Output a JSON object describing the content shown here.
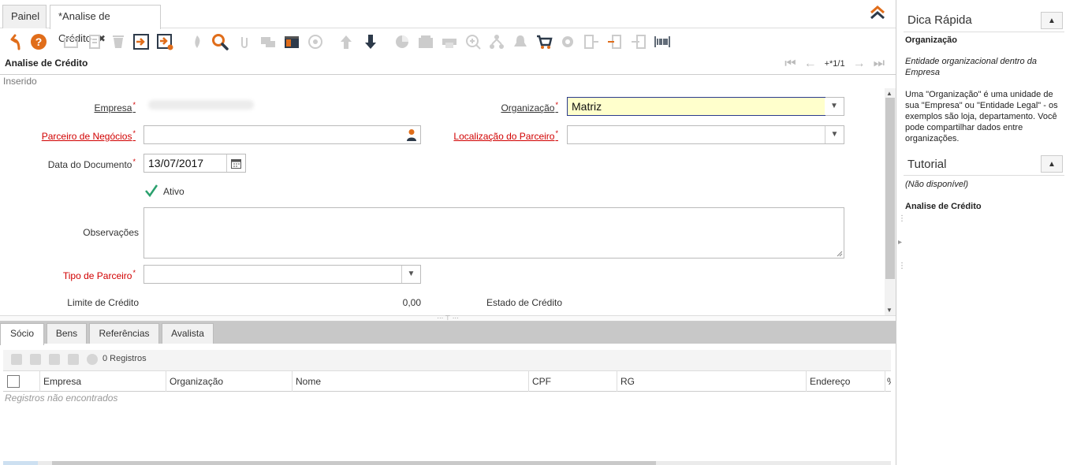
{
  "tabs": [
    {
      "label": "Painel"
    },
    {
      "label": "*Analise de Crédito",
      "close": "✖"
    }
  ],
  "colors": {
    "accent": "#e06d1a",
    "required": "#d10000",
    "highlight": "#ffffcc",
    "dark_icon": "#2d3a4a"
  },
  "toolbar": {
    "icons": [
      "undo-icon",
      "help-icon",
      "new-icon",
      "copy-icon",
      "delete-icon",
      "save-icon",
      "save-new-icon",
      "refresh-icon",
      "search-icon",
      "attach-icon",
      "chat-icon",
      "history-icon",
      "report-icon",
      "arrow-up-icon",
      "arrow-down-icon",
      "chart-icon",
      "archive-icon",
      "print-icon",
      "zoom-icon",
      "workflow-icon",
      "alert-icon",
      "cart-icon",
      "settings-icon",
      "export-icon",
      "import-icon",
      "logout-icon",
      "barcode-icon"
    ]
  },
  "form": {
    "title": "Analise de Crédito",
    "record_indicator": "+*1/1",
    "status": "Inserido",
    "fields": {
      "empresa": {
        "label": "Empresa"
      },
      "organizacao": {
        "label": "Organização",
        "value": "Matriz"
      },
      "parceiro": {
        "label": "Parceiro de Negócios",
        "value": ""
      },
      "localizacao": {
        "label": "Localização do Parceiro",
        "value": ""
      },
      "data_documento": {
        "label": "Data do Documento",
        "value": "13/07/2017"
      },
      "ativo": {
        "label": "Ativo",
        "checked": true
      },
      "observacoes": {
        "label": "Observações"
      },
      "tipo_parceiro": {
        "label": "Tipo de Parceiro",
        "value": ""
      },
      "limite_credito": {
        "label": "Limite de Crédito",
        "value": "0,00"
      },
      "estado_credito": {
        "label": "Estado de Crédito"
      }
    }
  },
  "detail": {
    "tabs": [
      {
        "label": "Sócio",
        "active": true
      },
      {
        "label": "Bens"
      },
      {
        "label": "Referências"
      },
      {
        "label": "Avalista"
      }
    ],
    "record_count": "0 Registros",
    "columns": [
      "Empresa",
      "Organização",
      "Nome",
      "CPF",
      "RG",
      "Endereço",
      "%"
    ],
    "empty_message": "Registros não encontrados"
  },
  "right_panel": {
    "quick_tip": {
      "title": "Dica Rápida",
      "field_name": "Organização",
      "short_desc": "Entidade organizacional dentro da Empresa",
      "long_desc": "Uma \"Organização\" é uma unidade de sua \"Empresa\" ou \"Entidade Legal\" - os exemplos são loja, departamento. Você pode compartilhar dados entre organizações."
    },
    "tutorial": {
      "title": "Tutorial",
      "text": "(Não disponível)",
      "window_name": "Analise de Crédito"
    }
  }
}
